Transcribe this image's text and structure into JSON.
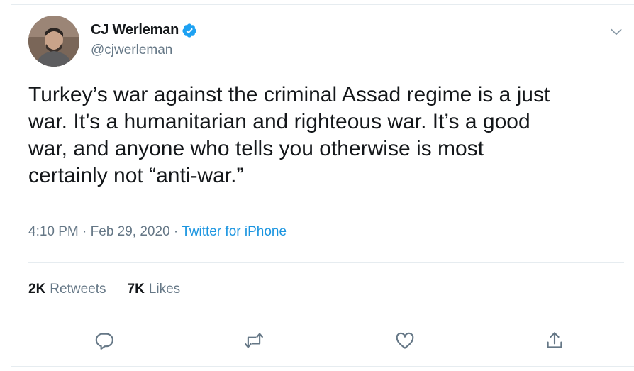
{
  "author": {
    "display_name": "CJ Werleman",
    "handle": "@cjwerleman",
    "verified": true
  },
  "tweet": {
    "text": "Turkey’s war against the criminal Assad regime is a just\nwar. It’s a humanitarian and righteous war. It’s a good\nwar, and anyone who tells you otherwise is most\ncertainly not “anti-war.”",
    "time": "4:10 PM",
    "date": "Feb 29, 2020",
    "separator": " · ",
    "source": "Twitter for iPhone"
  },
  "stats": {
    "retweets_count": "2K",
    "retweets_label": "Retweets",
    "likes_count": "7K",
    "likes_label": "Likes"
  },
  "icons": {
    "caret": "chevron-down-icon",
    "verified": "verified-badge-icon",
    "reply": "reply-icon",
    "retweet": "retweet-icon",
    "like": "heart-icon",
    "share": "share-icon"
  },
  "colors": {
    "text": "#14171a",
    "secondary": "#657786",
    "link": "#1b95e0",
    "verified": "#1da1f2",
    "border": "#e6ecf0"
  }
}
